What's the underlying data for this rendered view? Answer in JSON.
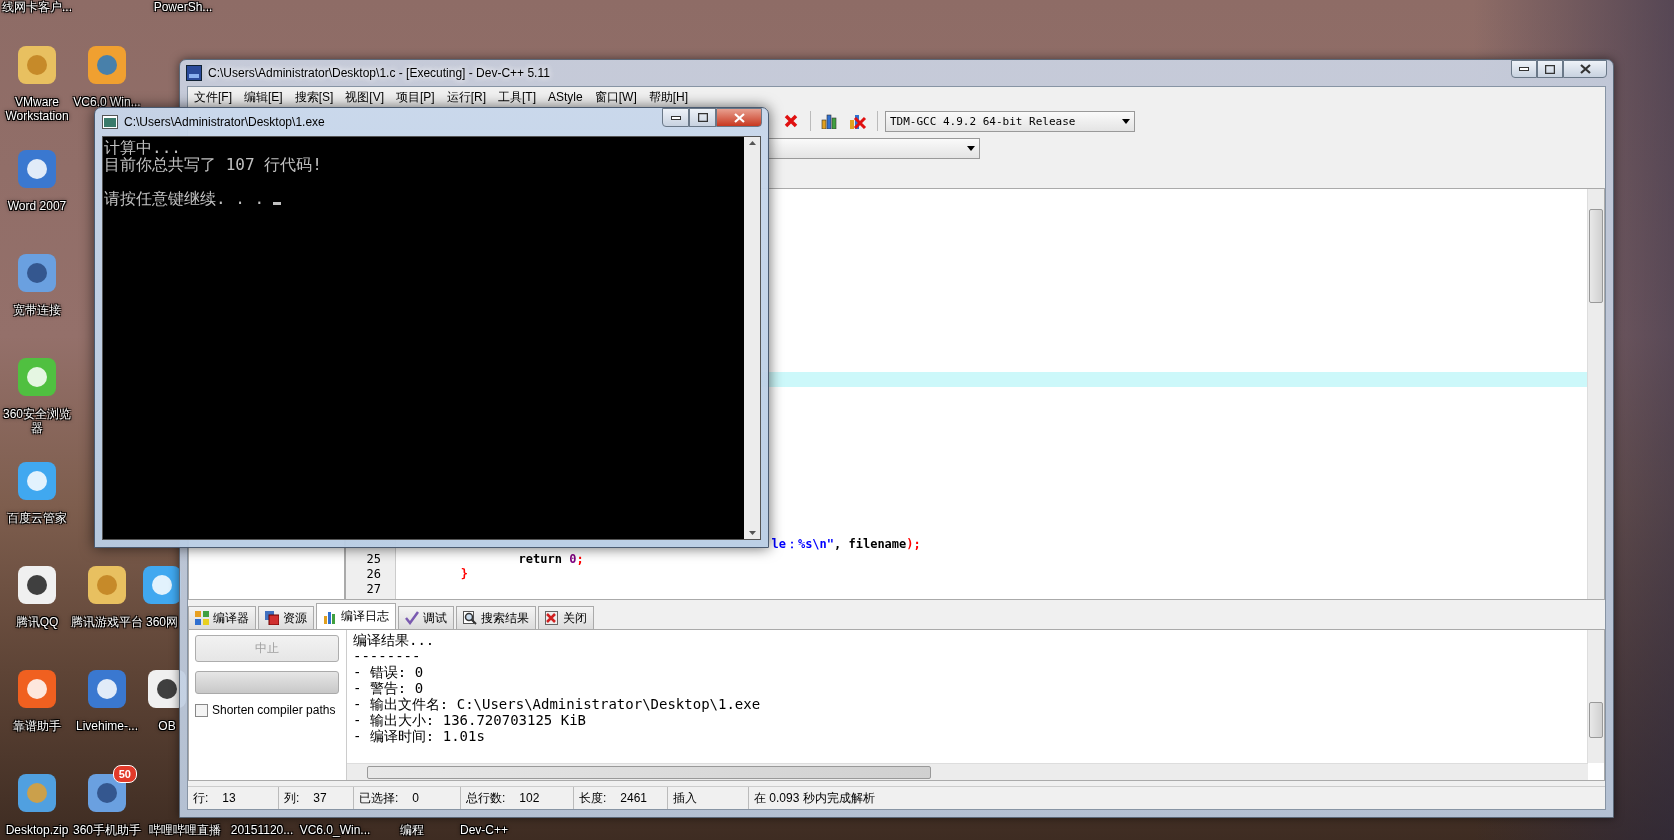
{
  "desktop": {
    "icons": [
      {
        "label": "线网卡客户..."
      },
      {
        "label": "VMware Workstation"
      },
      {
        "label": "Word 2007"
      },
      {
        "label": "宽带连接"
      },
      {
        "label": "360安全浏览器"
      },
      {
        "label": "百度云管家"
      },
      {
        "label": "腾讯QQ"
      },
      {
        "label": "靠谱助手"
      },
      {
        "label": "Desktop.zip"
      },
      {
        "label": "VC6.0 Win..."
      },
      {
        "label": "腾讯游戏平台"
      },
      {
        "label": "Livehime-..."
      },
      {
        "label": "360手机助手",
        "badge": "50"
      },
      {
        "label": "PowerSh..."
      },
      {
        "label": "360网"
      },
      {
        "label": "OB"
      },
      {
        "label": "哔哩哔哩直播"
      },
      {
        "label": "20151120..."
      },
      {
        "label": "VC6.0_Win..."
      },
      {
        "label": "编程"
      },
      {
        "label": "Dev-C++"
      }
    ]
  },
  "ide": {
    "title": "C:\\Users\\Administrator\\Desktop\\1.c - [Executing] - Dev-C++ 5.11",
    "menu": [
      "文件[F]",
      "编辑[E]",
      "搜索[S]",
      "视图[V]",
      "项目[P]",
      "运行[R]",
      "工具[T]",
      "AStyle",
      "窗口[W]",
      "帮助[H]"
    ],
    "compiler_select": {
      "value": "TDM-GCC 4.9.2 64-bit Release"
    },
    "editor": {
      "lines": [
        {
          "tokens": [
            {
              "text": "le：%s\\n\"",
              "kind": "string"
            },
            {
              "text": ", filename",
              "kind": "plain"
            },
            {
              "text": ");",
              "kind": "punct"
            }
          ]
        },
        {
          "number": "25",
          "tokens": [
            {
              "text": "return",
              "kind": "keyword"
            },
            {
              "text": " 0",
              "kind": "number"
            },
            {
              "text": ";",
              "kind": "punct"
            }
          ]
        },
        {
          "number": "26",
          "tokens": [
            {
              "text": "}",
              "kind": "punct"
            }
          ]
        },
        {
          "number": "27"
        }
      ]
    },
    "bottom_tabs": [
      {
        "label": "编译器",
        "selected": false
      },
      {
        "label": "资源",
        "selected": false
      },
      {
        "label": "编译日志",
        "selected": true
      },
      {
        "label": "调试",
        "selected": false
      },
      {
        "label": "搜索结果",
        "selected": false
      },
      {
        "label": "关闭",
        "selected": false
      }
    ],
    "compile_log": {
      "abort_button": {
        "label": "中止",
        "disabled": true
      },
      "progress": {
        "level": 0
      },
      "shorten_paths": {
        "label": "Shorten compiler paths",
        "checked": false
      },
      "lines": [
        "编译结果...",
        "--------",
        "- 错误: 0",
        "- 警告: 0",
        "- 输出文件名: C:\\Users\\Administrator\\Desktop\\1.exe",
        "- 输出大小: 136.720703125 KiB",
        "- 编译时间: 1.01s"
      ]
    },
    "status_bar": [
      {
        "label": "行:",
        "value": "13"
      },
      {
        "label": "列:",
        "value": "37"
      },
      {
        "label": "已选择:",
        "value": "0"
      },
      {
        "label": "总行数:",
        "value": "102"
      },
      {
        "label": "长度:",
        "value": "2461"
      },
      {
        "value": "插入"
      },
      {
        "value": "在 0.093 秒内完成解析"
      }
    ]
  },
  "console": {
    "title": "C:\\Users\\Administrator\\Desktop\\1.exe",
    "lines": [
      {
        "text": "计算中...",
        "blank_before": false
      },
      {
        "text": "目前你总共写了 107 行代码!",
        "blank_before": false
      },
      {
        "text": "请按任意键继续. . .",
        "blank_before": true
      }
    ]
  }
}
